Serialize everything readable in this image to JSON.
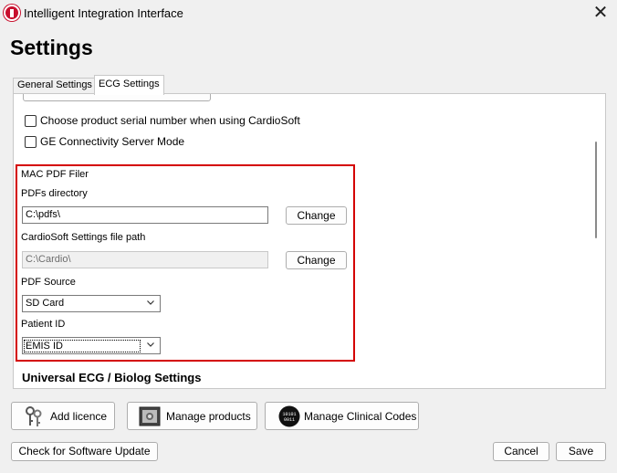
{
  "window": {
    "title": "Intelligent Integration Interface",
    "close_glyph": "✕"
  },
  "page_title": "Settings",
  "tabs": [
    {
      "label": "General Settings",
      "active": false
    },
    {
      "label": "ECG Settings",
      "active": true
    }
  ],
  "ecg": {
    "checkboxes": [
      {
        "label": "Choose product serial number when using CardioSoft",
        "checked": false
      },
      {
        "label": "GE Connectivity Server Mode",
        "checked": false
      }
    ],
    "mac_pdf": {
      "section_label": "MAC PDF Filer",
      "pdfs_dir_label": "PDFs directory",
      "pdfs_dir_value": "C:\\pdfs\\",
      "change_label": "Change",
      "cardiosoft_label": "CardioSoft Settings file path",
      "cardiosoft_value": "C:\\Cardio\\",
      "pdf_source_label": "PDF Source",
      "pdf_source_value": "SD Card",
      "patient_id_label": "Patient ID",
      "patient_id_value": "EMIS ID"
    },
    "universal_title": "Universal ECG / Biolog Settings"
  },
  "actions": {
    "add_licence": "Add licence",
    "manage_products": "Manage products",
    "manage_clinical_codes": "Manage Clinical Codes",
    "check_update": "Check for Software Update",
    "cancel": "Cancel",
    "save": "Save"
  },
  "colors": {
    "highlight": "#d40000",
    "app_icon": "#c8102e"
  }
}
